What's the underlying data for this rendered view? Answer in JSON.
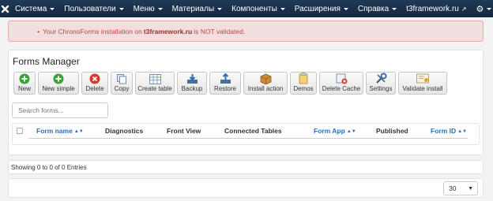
{
  "navbar": {
    "menu": [
      "Система",
      "Пользователи",
      "Меню",
      "Материалы",
      "Компоненты",
      "Расширения",
      "Справка"
    ],
    "site_name": "t3framework.ru",
    "icons": {
      "brand": "joomla-logo-icon",
      "site": "external-link-icon",
      "settings": "gear-icon"
    }
  },
  "alert": {
    "prefix": "Your ChronoForms installation on",
    "domain": "t3framework.ru",
    "suffix": "is NOT validated."
  },
  "manager": {
    "title": "Forms Manager",
    "toolbar": [
      {
        "label": "New",
        "icon": "plus-green-icon"
      },
      {
        "label": "New simple",
        "icon": "plus-green-icon"
      },
      {
        "label": "Delete",
        "icon": "delete-red-icon"
      },
      {
        "label": "Copy",
        "icon": "copy-icon"
      },
      {
        "label": "Create table",
        "icon": "table-icon"
      },
      {
        "label": "Backup",
        "icon": "download-icon"
      },
      {
        "label": "Restore",
        "icon": "upload-icon"
      },
      {
        "label": "Install action",
        "icon": "box-icon"
      },
      {
        "label": "Demos",
        "icon": "clipboard-icon"
      },
      {
        "label": "Delete Cache",
        "icon": "delete-cache-icon"
      },
      {
        "label": "Settings",
        "icon": "tools-icon"
      },
      {
        "label": "Validate install",
        "icon": "certificate-icon"
      }
    ],
    "search_placeholder": "Search forms...",
    "columns": [
      {
        "label": "Form name",
        "sortable": true
      },
      {
        "label": "Diagnostics",
        "sortable": false
      },
      {
        "label": "Front View",
        "sortable": false
      },
      {
        "label": "Connected Tables",
        "sortable": false
      },
      {
        "label": "Form App",
        "sortable": true
      },
      {
        "label": "Published",
        "sortable": false
      },
      {
        "label": "Form ID",
        "sortable": true
      }
    ]
  },
  "footer": {
    "showing": "Showing 0 to 0 of 0 Entries",
    "per_page": "30"
  },
  "colors": {
    "navbar": "#1a3149",
    "alert_bg": "#f2dede",
    "alert_text": "#b94a48",
    "link": "#2a6ebb"
  }
}
